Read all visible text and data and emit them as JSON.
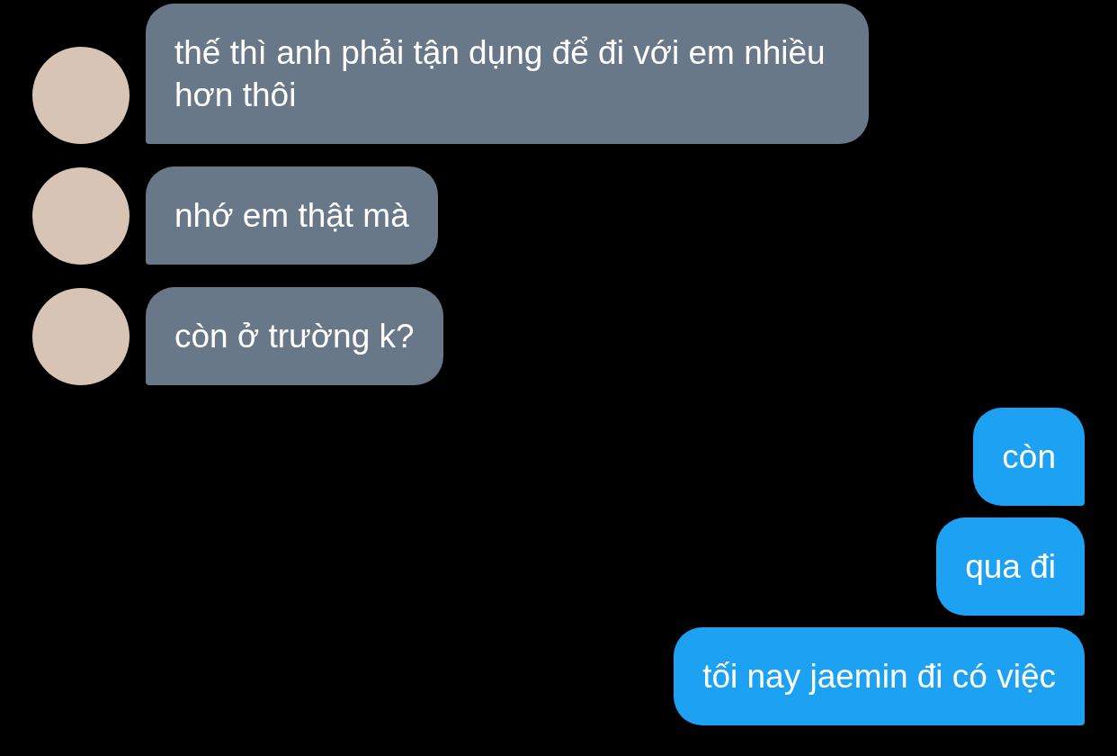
{
  "messages": [
    {
      "kind": "incoming",
      "text": "thế thì anh phải tận dụng để đi với em nhiều hơn thôi"
    },
    {
      "kind": "incoming",
      "text": "nhớ em thật mà"
    },
    {
      "kind": "incoming",
      "text": "còn ở trường k?"
    },
    {
      "kind": "outgoing",
      "text": "còn"
    },
    {
      "kind": "outgoing",
      "text": "qua đi"
    },
    {
      "kind": "outgoing",
      "text": "tối nay jaemin đi có việc"
    }
  ]
}
